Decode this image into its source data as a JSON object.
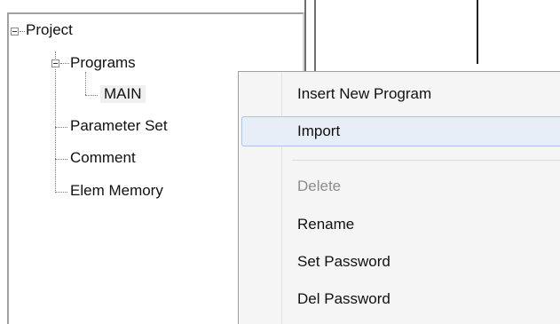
{
  "tree": {
    "root_label": "Project",
    "programs_label": "Programs",
    "main_label": "MAIN",
    "parameter_set_label": "Parameter Set",
    "comment_label": "Comment",
    "elem_memory_label": "Elem Memory"
  },
  "context_menu": {
    "items": [
      {
        "label": "Insert New Program",
        "state": "normal"
      },
      {
        "label": "Import",
        "state": "hover"
      },
      {
        "label": "Delete",
        "state": "disabled"
      },
      {
        "label": "Rename",
        "state": "normal"
      },
      {
        "label": "Set Password",
        "state": "normal"
      },
      {
        "label": "Del Password",
        "state": "normal"
      }
    ]
  },
  "colors": {
    "menu_background": "#f5f5f5",
    "hover_background": "#e7eef7",
    "hover_border": "#adc5e2",
    "disabled_text": "#8c8c8c"
  }
}
